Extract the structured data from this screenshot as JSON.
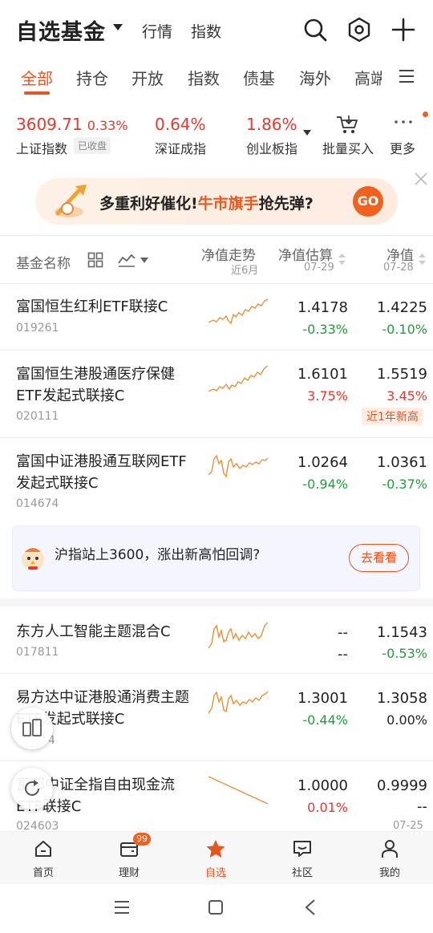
{
  "header": {
    "title": "自选基金",
    "links": [
      "行情",
      "指数"
    ]
  },
  "tabs": [
    "全部",
    "持仓",
    "开放",
    "指数",
    "债基",
    "海外",
    "高端"
  ],
  "indices": [
    {
      "name": "上证指数",
      "value": "3609.71",
      "change": "0.33%",
      "tag": "已收盘"
    },
    {
      "name": "深证成指",
      "value": "0.64%"
    },
    {
      "name": "创业板指",
      "value": "1.86%"
    }
  ],
  "tools": {
    "batch_buy": "批量买入",
    "more": "更多"
  },
  "banner": {
    "text_before": "多重利好催化!",
    "text_highlight": "牛市旗手",
    "text_after": "抢先弹?",
    "go": "GO"
  },
  "table_header": {
    "name": "基金名称",
    "trend": "净值走势",
    "trend_sub": "近6月",
    "estimate": "净值估算",
    "estimate_date": "07-29",
    "nav": "净值",
    "nav_date": "07-28"
  },
  "funds": [
    {
      "name": "富国恒生红利ETF联接C",
      "code": "019261",
      "est": "1.4178",
      "est_pct": "-0.33%",
      "nav": "1.4225",
      "nav_pct": "-0.10%"
    },
    {
      "name": "富国恒生港股通医疗保健ETF发起式联接C",
      "code": "020111",
      "est": "1.6101",
      "est_pct": "3.75%",
      "nav": "1.5519",
      "nav_pct": "3.45%",
      "tag": "近1年新高"
    },
    {
      "name": "富国中证港股通互联网ETF发起式联接C",
      "code": "014674",
      "est": "1.0264",
      "est_pct": "-0.94%",
      "nav": "1.0361",
      "nav_pct": "-0.37%"
    },
    {
      "name": "东方人工智能主题混合C",
      "code": "017811",
      "est": "--",
      "est_pct": "--",
      "nav": "1.1543",
      "nav_pct": "-0.53%"
    },
    {
      "name": "易方达中证港股通消费主题ETF发起式联接C",
      "code": "014",
      "est": "1.3001",
      "est_pct": "-0.44%",
      "nav": "1.3058",
      "nav_pct": "0.00%"
    },
    {
      "name": "富邦中证全指自由现金流ETF联接C",
      "code": "024603",
      "est": "1.0000",
      "est_pct": "0.01%",
      "nav": "0.9999",
      "nav_pct": "--",
      "nav_date": "07-25"
    }
  ],
  "promo": {
    "text": "沪指站上3600，涨出新高怕回调?",
    "button": "去看看"
  },
  "bottom_nav": [
    {
      "label": "首页"
    },
    {
      "label": "理财",
      "badge": "99"
    },
    {
      "label": "自选"
    },
    {
      "label": "社区"
    },
    {
      "label": "我的"
    }
  ],
  "colors": {
    "accent": "#e8541e",
    "up": "#e33a2f",
    "down": "#1f9e3a"
  }
}
